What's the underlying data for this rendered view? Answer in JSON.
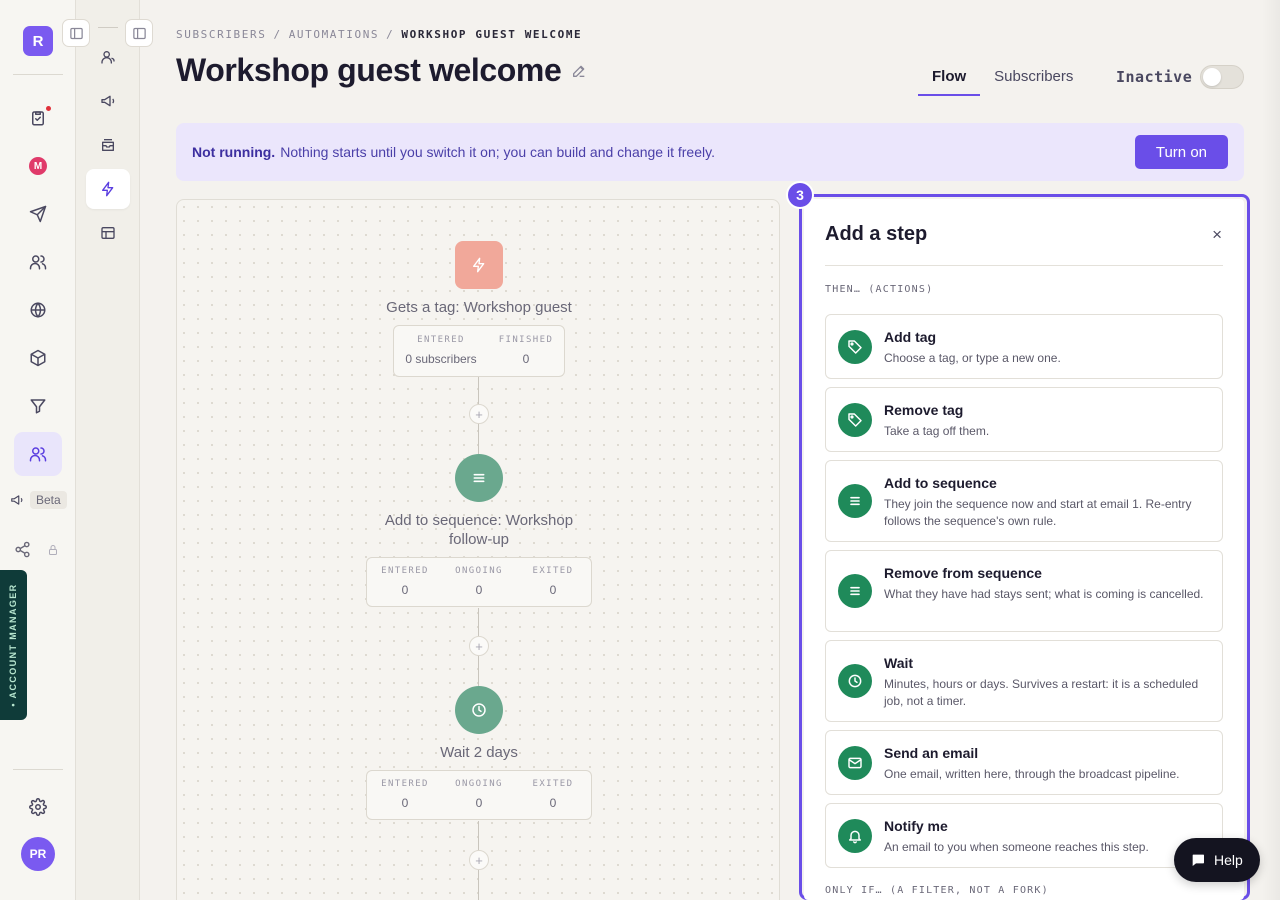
{
  "app": {
    "logo_letter": "R",
    "avatar_initials": "PR",
    "beta_label": "Beta",
    "account_manager_label": "• ACCOUNT MANAGER"
  },
  "breadcrumb": {
    "items": [
      "SUBSCRIBERS",
      "AUTOMATIONS"
    ],
    "separator": "/",
    "current": "WORKSHOP GUEST WELCOME"
  },
  "page": {
    "title": "Workshop guest welcome"
  },
  "tabs": [
    {
      "label": "Flow",
      "active": true
    },
    {
      "label": "Subscribers",
      "active": false
    }
  ],
  "status": {
    "label": "Inactive",
    "enabled": false
  },
  "banner": {
    "strong": "Not running.",
    "text": "Nothing starts until you switch it on; you can build and change it freely.",
    "button": "Turn on"
  },
  "flow": {
    "nodes": [
      {
        "label": "Gets a tag: Workshop guest",
        "icon": "lightning-icon",
        "stats": [
          {
            "h": "ENTERED",
            "v": "0 subscribers"
          },
          {
            "h": "FINISHED",
            "v": "0"
          }
        ]
      },
      {
        "label": "Add to sequence: Workshop follow-up",
        "icon": "list-icon",
        "stats": [
          {
            "h": "ENTERED",
            "v": "0"
          },
          {
            "h": "ONGOING",
            "v": "0"
          },
          {
            "h": "EXITED",
            "v": "0"
          }
        ]
      },
      {
        "label": "Wait 2 days",
        "icon": "clock-icon",
        "stats": [
          {
            "h": "ENTERED",
            "v": "0"
          },
          {
            "h": "ONGOING",
            "v": "0"
          },
          {
            "h": "EXITED",
            "v": "0"
          }
        ]
      }
    ],
    "plus_symbol": "+"
  },
  "panel": {
    "step_number": "3",
    "title": "Add a step",
    "close_symbol": "×",
    "section_actions": "THEN… (ACTIONS)",
    "section_filter": "ONLY IF… (A FILTER, NOT A FORK)",
    "actions": [
      {
        "title": "Add tag",
        "desc": "Choose a tag, or type a new one.",
        "icon": "tag-icon"
      },
      {
        "title": "Remove tag",
        "desc": "Take a tag off them.",
        "icon": "tag-icon"
      },
      {
        "title": "Add to sequence",
        "desc": "They join the sequence now and start at email 1. Re-entry follows the sequence's own rule.",
        "icon": "list-icon"
      },
      {
        "title": "Remove from sequence",
        "desc": "What they have had stays sent; what is coming is cancelled.",
        "icon": "list-icon"
      },
      {
        "title": "Wait",
        "desc": "Minutes, hours or days. Survives a restart: it is a scheduled job, not a timer.",
        "icon": "clock-icon"
      },
      {
        "title": "Send an email",
        "desc": "One email, written here, through the broadcast pipeline.",
        "icon": "mail-icon"
      },
      {
        "title": "Notify me",
        "desc": "An email to you when someone reaches this step.",
        "icon": "bell-icon"
      }
    ]
  },
  "help": {
    "label": "Help"
  },
  "colors": {
    "accent": "#6a4ee8",
    "action_green": "#1f8a5a",
    "node_green": "#6aa88e",
    "trigger": "#f1a89a"
  }
}
